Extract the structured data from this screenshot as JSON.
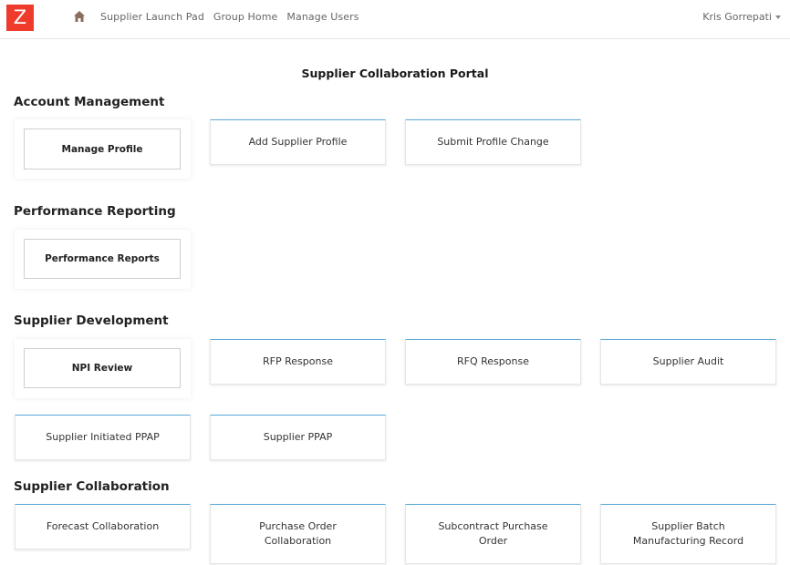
{
  "header": {
    "logo_letter": "Z",
    "nav": [
      "Supplier Launch Pad",
      "Group Home",
      "Manage Users"
    ],
    "user_name": "Kris Gorrepati"
  },
  "portal_title": "Supplier Collaboration Portal",
  "sections": {
    "account_management": {
      "heading": "Account Management",
      "tiles": [
        "Manage Profile",
        "Add Supplier Profile",
        "Submit Profile Change"
      ]
    },
    "performance_reporting": {
      "heading": "Performance Reporting",
      "tiles": [
        "Performance Reports"
      ]
    },
    "supplier_development": {
      "heading": "Supplier Development",
      "tiles": [
        "NPI Review",
        "RFP Response",
        "RFQ Response",
        "Supplier Audit",
        "Supplier Initiated PPAP",
        "Supplier PPAP"
      ]
    },
    "supplier_collaboration": {
      "heading": "Supplier Collaboration",
      "tiles": [
        [
          "Forecast Collaboration"
        ],
        [
          "Purchase Order",
          "Collaboration"
        ],
        [
          "Subcontract Purchase",
          "Order"
        ],
        [
          "Supplier Batch",
          "Manufacturing Record"
        ]
      ]
    }
  },
  "colors": {
    "logo_red": "#ef3b2c",
    "tile_accent": "#5aa8d6"
  },
  "icons": {
    "home": "home-icon",
    "user_menu": "chevron-down-icon"
  }
}
